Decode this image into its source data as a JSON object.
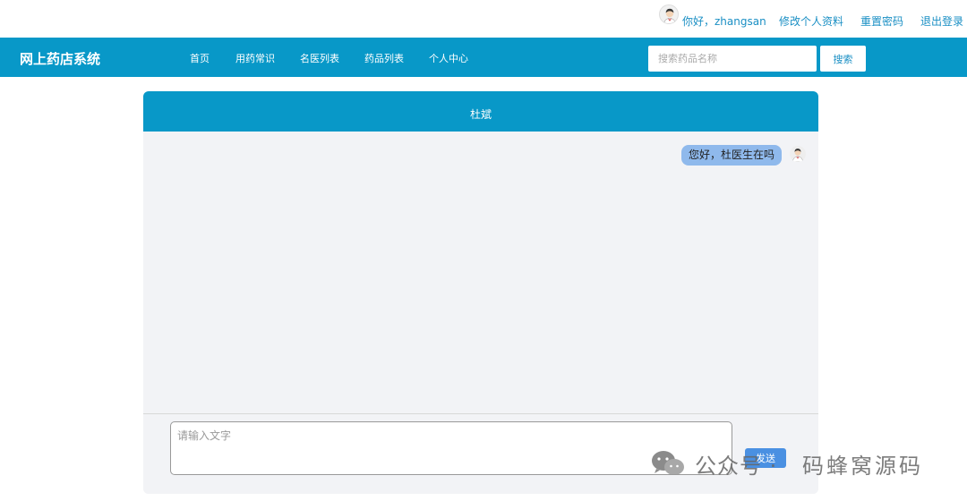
{
  "userbar": {
    "greeting": "你好，zhangsan",
    "edit_profile": "修改个人资料",
    "reset_password": "重置密码",
    "logout": "退出登录"
  },
  "navbar": {
    "brand": "网上药店系统",
    "items": [
      {
        "label": "首页"
      },
      {
        "label": "用药常识"
      },
      {
        "label": "名医列表"
      },
      {
        "label": "药品列表"
      },
      {
        "label": "个人中心"
      }
    ],
    "search": {
      "placeholder": "搜索药品名称",
      "value": "",
      "button_label": "搜索"
    }
  },
  "chat": {
    "title": "杜斌",
    "messages": [
      {
        "from": "self",
        "text": "您好，杜医生在吗"
      }
    ],
    "input": {
      "placeholder": "请输入文字",
      "value": ""
    },
    "send_label": "发送"
  },
  "watermark": {
    "account": "公众号 ·",
    "name": "码蜂窝源码"
  },
  "colors": {
    "primary": "#0898c8",
    "link": "#1a8fc4",
    "bubble": "#8fb9ec",
    "send_button": "#4a90e2",
    "chat_bg": "#f2f3f6"
  }
}
